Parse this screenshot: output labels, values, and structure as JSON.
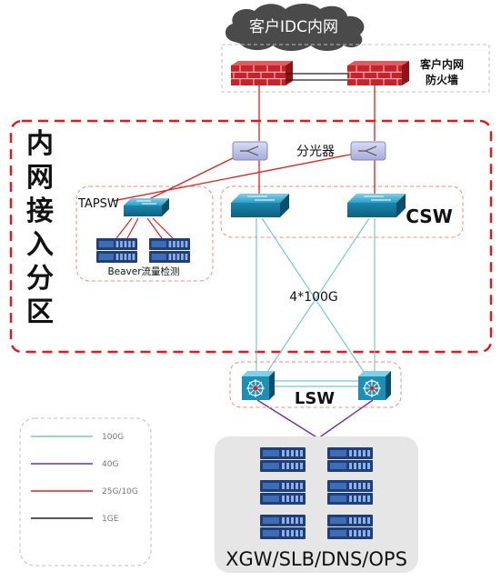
{
  "cloud_label": "客户IDC内网",
  "firewall_label_line1": "客户内网",
  "firewall_label_line2": "防火墙",
  "splitter_label": "分光器",
  "zone_title_chars": [
    "内",
    "网",
    "接",
    "入",
    "分",
    "区"
  ],
  "tapsw_label": "TAPSW",
  "beaver_label": "Beaver流量检测",
  "csw_label": "CSW",
  "uplink_label": "4*100G",
  "lsw_label": "LSW",
  "server_area_label": "XGW/SLB/DNS/OPS",
  "legend": [
    {
      "label": "100G",
      "color": "#74c8d8"
    },
    {
      "label": "40G",
      "color": "#7030a0"
    },
    {
      "label": "25G/10G",
      "color": "#e02020"
    },
    {
      "label": "1GE",
      "color": "#222222"
    }
  ],
  "colors": {
    "zone_border": "#e8151b",
    "dashed_group_border": "#f08a7a",
    "switch_blue": "#1b8fb5",
    "server_navy": "#1f3f7a",
    "firewall_red": "#c4242c",
    "server_area_bg": "#e6e6e6"
  }
}
